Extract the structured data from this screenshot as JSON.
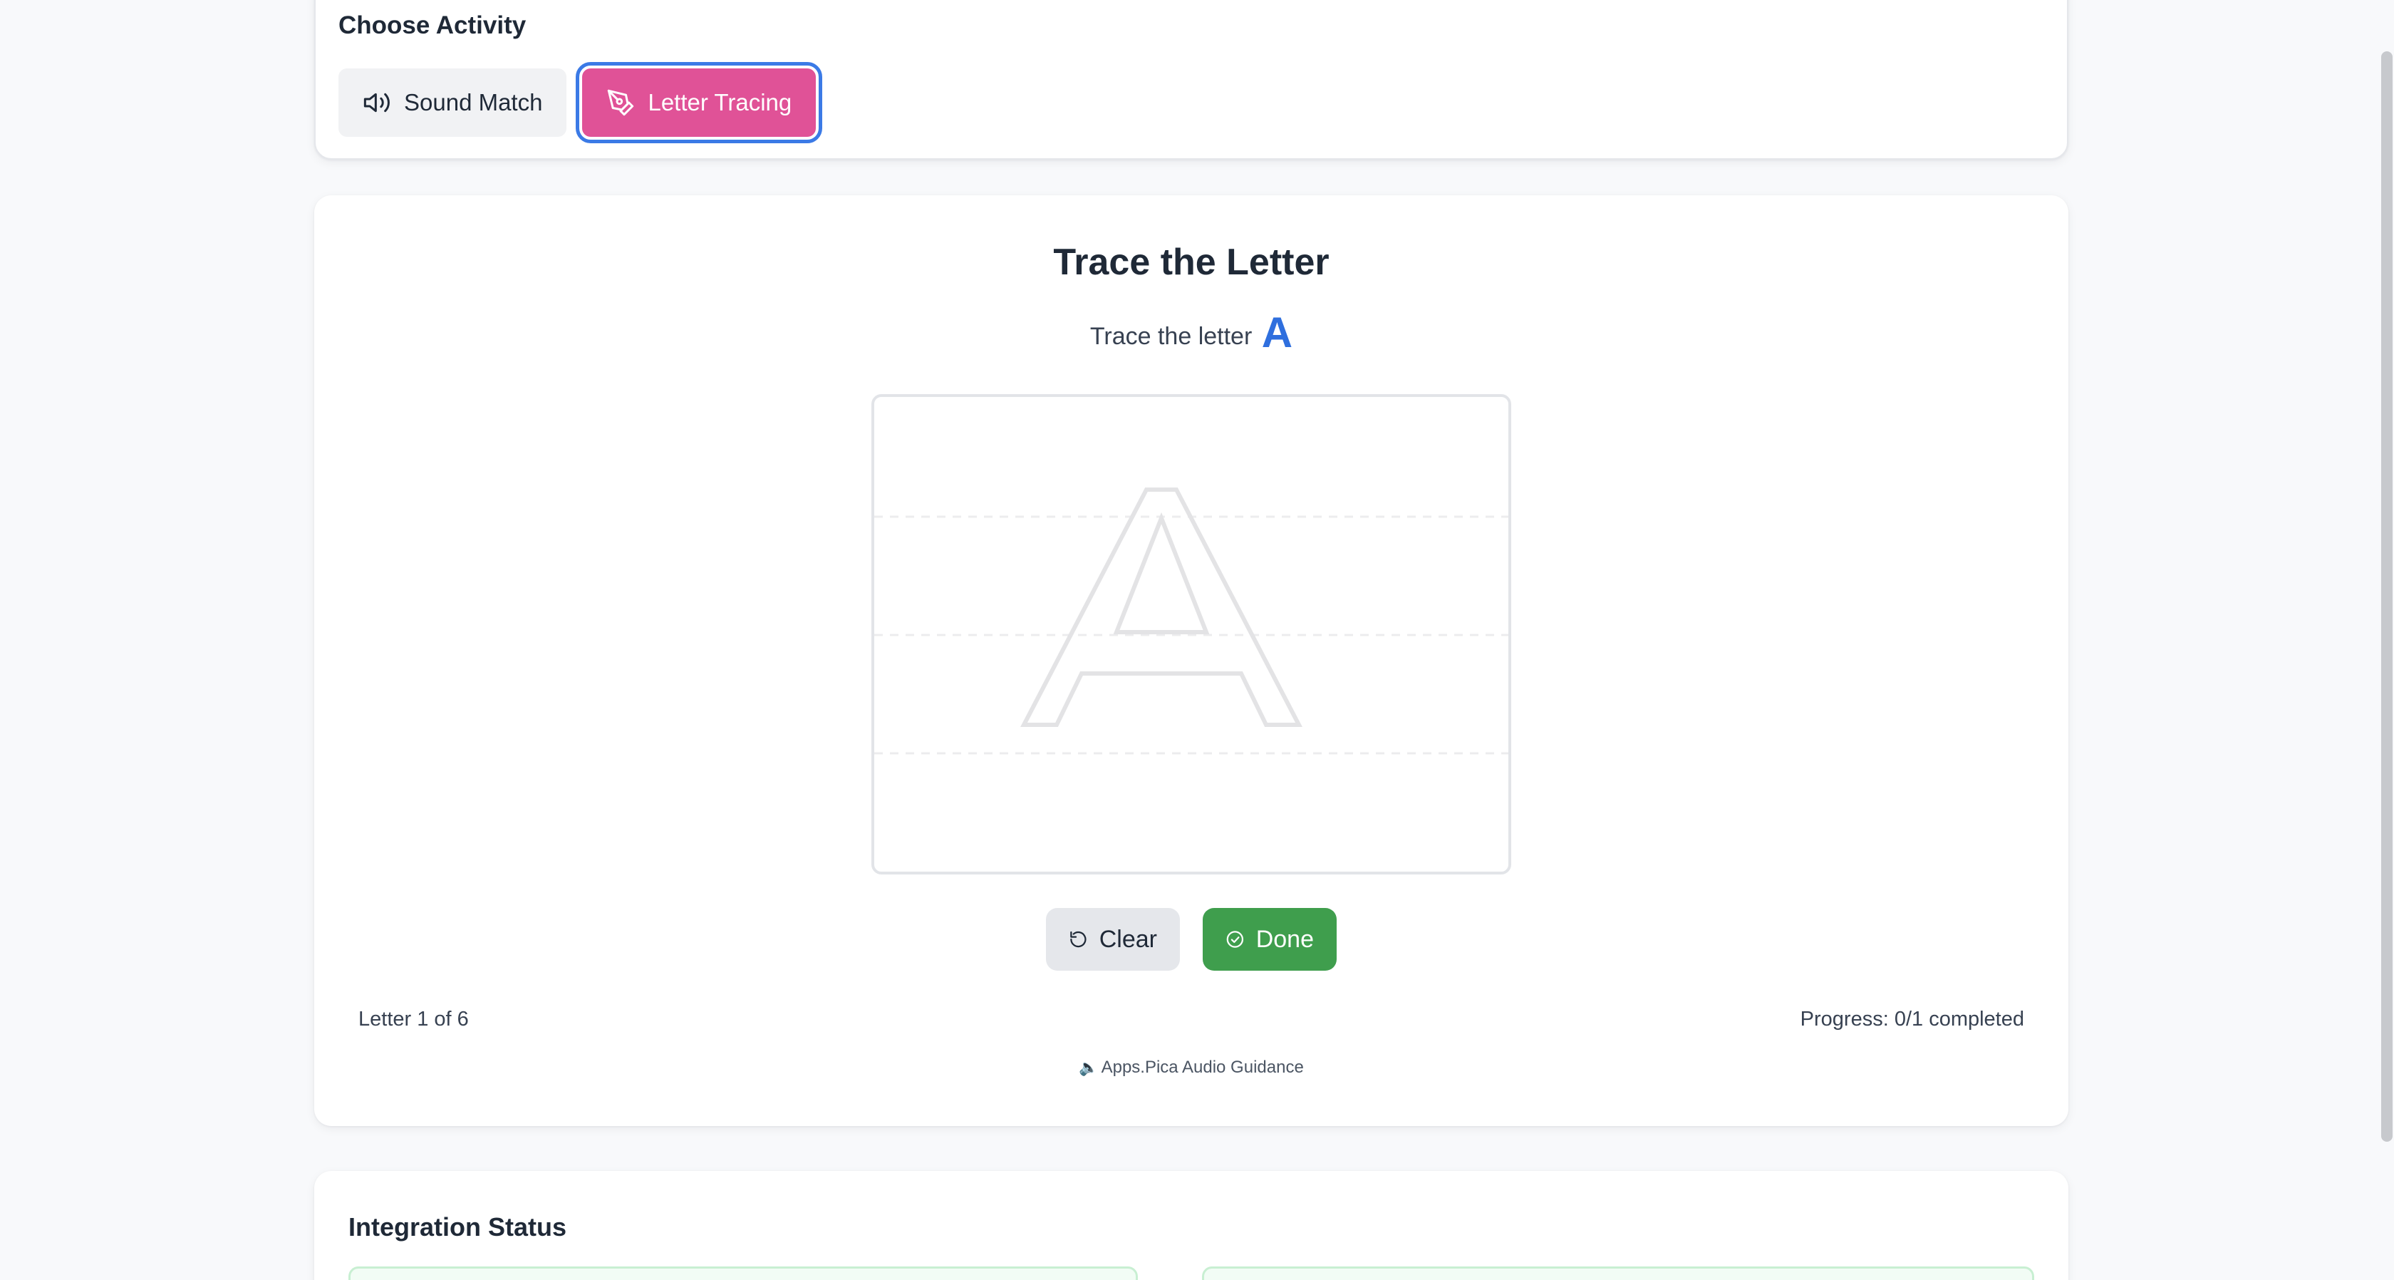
{
  "activity": {
    "title": "Choose Activity",
    "buttons": [
      {
        "label": "Sound Match",
        "icon": "speaker-icon",
        "selected": false
      },
      {
        "label": "Letter Tracing",
        "icon": "pen-icon",
        "selected": true
      }
    ],
    "selected_color": "#e05297"
  },
  "tracing": {
    "title": "Trace the Letter",
    "prompt": "Trace the letter",
    "letter": "A",
    "letter_color": "#2f6fde",
    "clear_label": "Clear",
    "clear_icon": "rotate-ccw-icon",
    "done_label": "Done",
    "done_icon": "check-circle-icon",
    "done_color": "#3f9e4d",
    "letter_count": "Letter 1 of 6",
    "progress": "Progress: 0/1 completed",
    "audio_icon": "speaker-emoji-icon",
    "audio_guidance": "Apps.Pica Audio Guidance"
  },
  "integration": {
    "title": "Integration Status"
  }
}
